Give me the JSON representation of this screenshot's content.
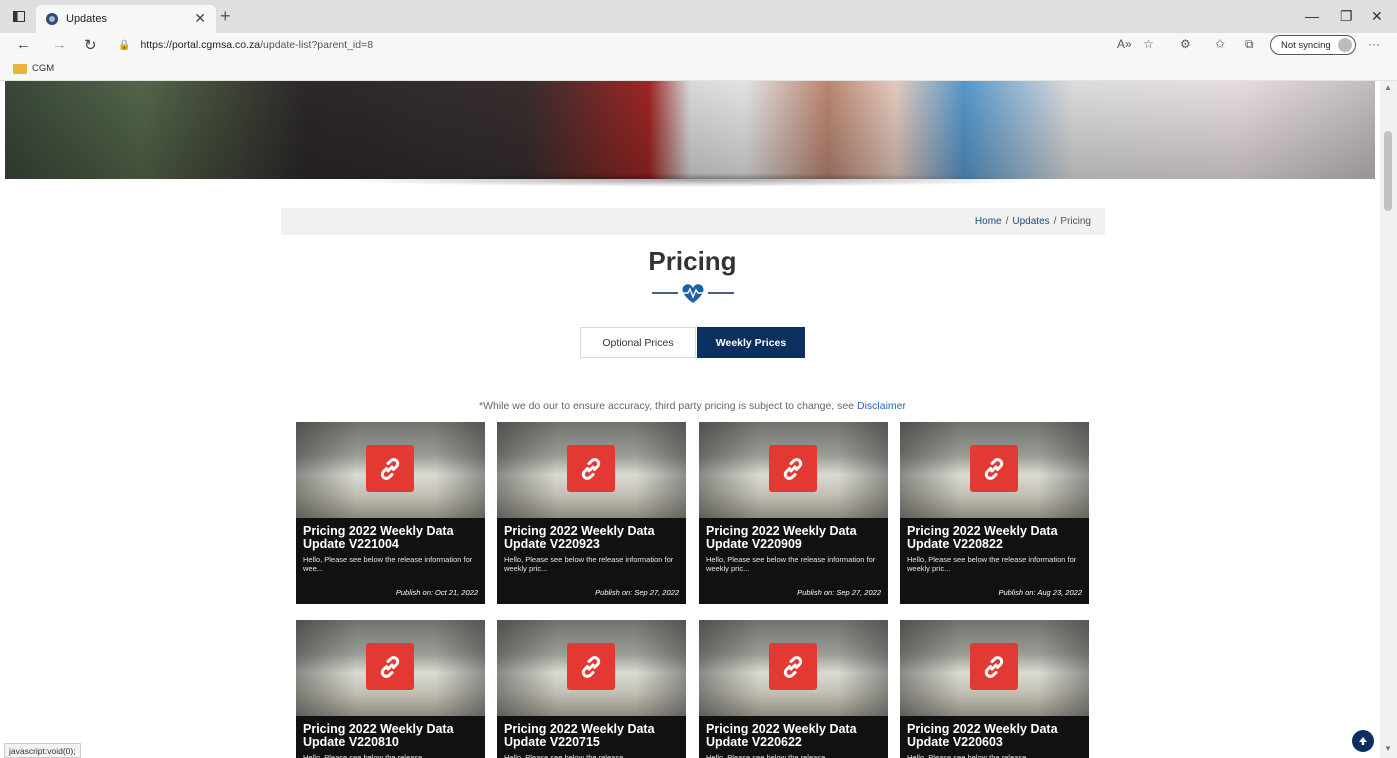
{
  "browser": {
    "tab_title": "Updates",
    "url_host": "https://portal.cgmsa.co.za",
    "url_path": "/update-list?parent_id=8",
    "sync_label": "Not syncing",
    "bookmark": "CGM",
    "status_text": "javascript:void(0);"
  },
  "breadcrumb": {
    "home": "Home",
    "sep1": "/",
    "updates": "Updates",
    "sep2": "/",
    "current": "Pricing"
  },
  "page": {
    "title": "Pricing",
    "tabs": [
      {
        "label": "Optional Prices",
        "active": false
      },
      {
        "label": "Weekly Prices",
        "active": true
      }
    ],
    "note_text": "*While we do our to ensure accuracy, third party pricing is subject to change, see",
    "note_link": "Disclaimer"
  },
  "cards": [
    {
      "title": "Pricing 2022 Weekly Data Update V221004",
      "excerpt": "Hello,   Please see below the release information for wee...",
      "date": "Publish on: Oct 21, 2022"
    },
    {
      "title": "Pricing 2022 Weekly Data Update V220923",
      "excerpt": "Hello,   Please see below the release information for weekly pric...",
      "date": "Publish on: Sep 27, 2022"
    },
    {
      "title": "Pricing 2022 Weekly Data Update V220909",
      "excerpt": "Hello,   Please see below the release information for weekly pric...",
      "date": "Publish on: Sep 27, 2022"
    },
    {
      "title": "Pricing 2022 Weekly Data Update V220822",
      "excerpt": "Hello,   Please see below the release information for weekly pric...",
      "date": "Publish on: Aug 23, 2022"
    },
    {
      "title": "Pricing 2022 Weekly Data Update V220810",
      "excerpt": "Hello,   Please see below the release",
      "date": ""
    },
    {
      "title": "Pricing 2022 Weekly Data Update V220715",
      "excerpt": "Hello,   Please see below the release",
      "date": ""
    },
    {
      "title": "Pricing 2022 Weekly Data Update V220622",
      "excerpt": "Hello,   Please see below the release",
      "date": ""
    },
    {
      "title": "Pricing 2022 Weekly Data Update V220603",
      "excerpt": "Hello,   Please see below the release",
      "date": ""
    }
  ],
  "colors": {
    "accent_navy": "#0b2f5e",
    "link_blue": "#2a66b4",
    "badge_red": "#e23a33",
    "card_bg": "#111111"
  },
  "icons": [
    "window-icon",
    "close-icon",
    "new-tab-icon",
    "back-icon",
    "forward-icon",
    "refresh-icon",
    "lock-icon",
    "read-aloud-icon",
    "favorite-icon",
    "extensions-icon",
    "favorites-bar-icon",
    "collections-icon",
    "more-icon",
    "folder-icon",
    "heartbeat-icon",
    "link-icon",
    "arrow-up-icon"
  ]
}
